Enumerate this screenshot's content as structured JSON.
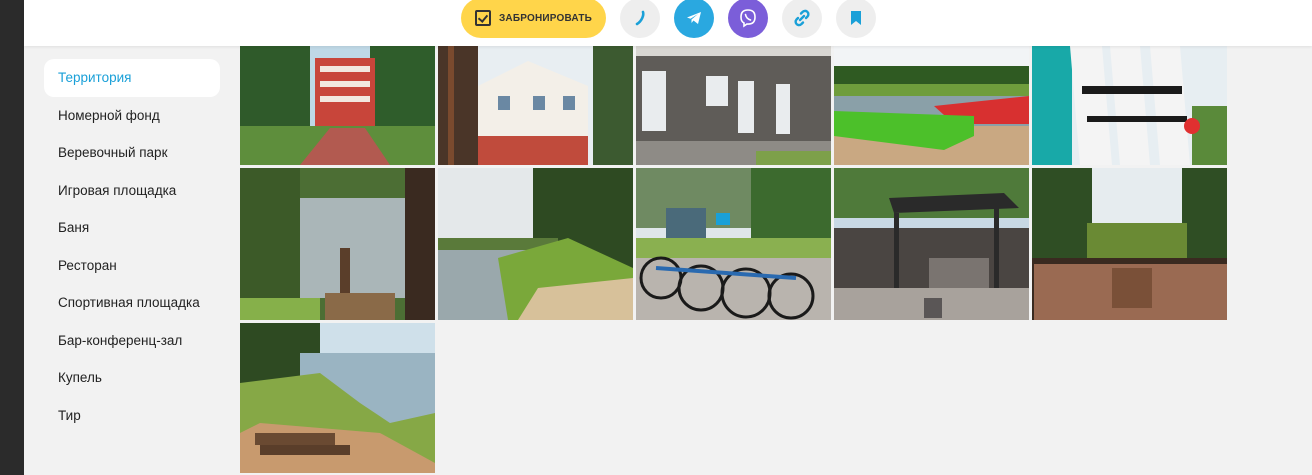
{
  "header": {
    "book_label": "ЗАБРОНИРОВАТЬ",
    "buttons": [
      {
        "name": "phone-icon-button",
        "color": "#eeeeee",
        "icon": "phone-icon"
      },
      {
        "name": "telegram-icon-button",
        "color": "#2aa8e0",
        "icon": "telegram-icon"
      },
      {
        "name": "viber-icon-button",
        "color": "#7b5ed9",
        "icon": "viber-icon"
      },
      {
        "name": "link-icon-button",
        "color": "#eeeeee",
        "icon": "link-icon"
      },
      {
        "name": "bookmark-icon-button",
        "color": "#eeeeee",
        "icon": "bookmark-icon"
      }
    ]
  },
  "sidebar": {
    "items": [
      {
        "label": "Территория",
        "active": true
      },
      {
        "label": "Номерной фонд",
        "active": false
      },
      {
        "label": "Веревочный парк",
        "active": false
      },
      {
        "label": "Игровая площадка",
        "active": false
      },
      {
        "label": "Баня",
        "active": false
      },
      {
        "label": "Ресторан",
        "active": false
      },
      {
        "label": "Спортивная площадка",
        "active": false
      },
      {
        "label": "Бар-конференц-зал",
        "active": false
      },
      {
        "label": "Купель",
        "active": false
      },
      {
        "label": "Тир",
        "active": false
      }
    ]
  },
  "gallery": {
    "photos": [
      {
        "subject": "red-hotel-building"
      },
      {
        "subject": "brick-cottage-in-pines"
      },
      {
        "subject": "wooden-house-porch"
      },
      {
        "subject": "kayaks-on-riverbank"
      },
      {
        "subject": "sup-boards"
      },
      {
        "subject": "stairs-to-river"
      },
      {
        "subject": "river-forest-bank"
      },
      {
        "subject": "bicycle-parking"
      },
      {
        "subject": "bbq-gazebo"
      },
      {
        "subject": "wooden-deck-with-tables"
      },
      {
        "subject": "sandy-path-to-water"
      }
    ]
  },
  "colors": {
    "accent": "#1aa0d8",
    "book_button": "#ffd54a",
    "background": "#f2f2f2"
  }
}
